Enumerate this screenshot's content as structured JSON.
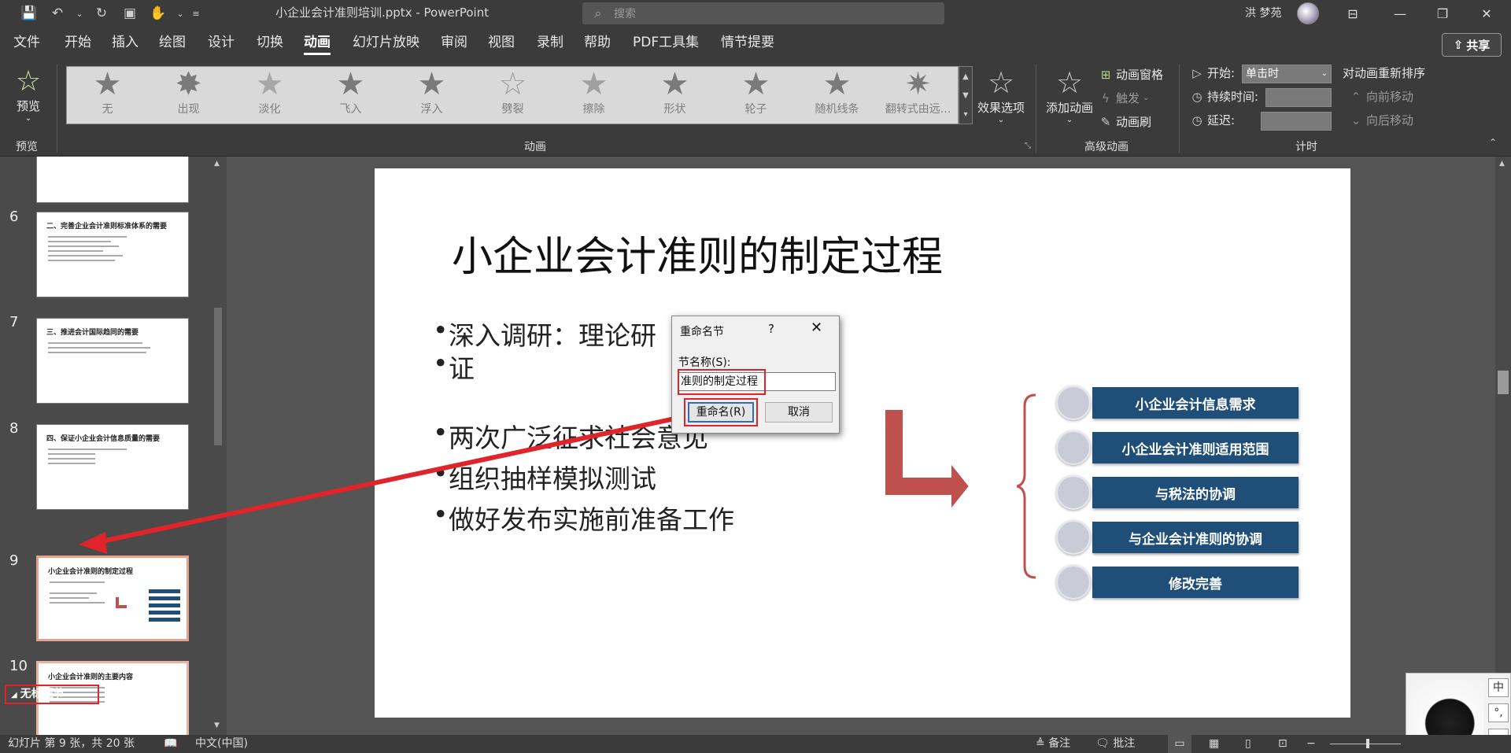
{
  "titlebar": {
    "doc_title": "小企业会计准则培训.pptx  -  PowerPoint",
    "search_placeholder": "搜索",
    "user_name": "洪 梦苑"
  },
  "tabs": [
    "文件",
    "开始",
    "插入",
    "绘图",
    "设计",
    "切换",
    "动画",
    "幻灯片放映",
    "审阅",
    "视图",
    "录制",
    "帮助",
    "PDF工具集",
    "情节提要"
  ],
  "active_tab": "动画",
  "share_label": "共享",
  "ribbon": {
    "preview_label": "预览",
    "preview_group": "预览",
    "animation_group": "动画",
    "animations": [
      "无",
      "出现",
      "淡化",
      "飞入",
      "浮入",
      "劈裂",
      "擦除",
      "形状",
      "轮子",
      "随机线条",
      "翻转式由远..."
    ],
    "effect_options": "效果选项",
    "add_animation": "添加动画",
    "animation_pane": "动画窗格",
    "trigger": "触发",
    "animation_painter": "动画刷",
    "advanced_group": "高级动画",
    "start_label": "开始:",
    "start_value": "单击时",
    "duration_label": "持续时间:",
    "delay_label": "延迟:",
    "reorder_label": "对动画重新排序",
    "move_earlier": "向前移动",
    "move_later": "向后移动",
    "timing_group": "计时"
  },
  "thumbnails": [
    {
      "num": "6",
      "title": "二、完善企业会计准则标准体系的需要"
    },
    {
      "num": "7",
      "title": "三、推进会计国际趋同的需要"
    },
    {
      "num": "8",
      "title": "四、保证小企业会计信息质量的需要"
    },
    {
      "num": "9",
      "title": "小企业会计准则的制定过程"
    },
    {
      "num": "10",
      "title": "小企业会计准则的主要内容"
    }
  ],
  "section_header": "无标题节",
  "slide": {
    "title": "小企业会计准则的制定过程",
    "bullets": [
      "深入调研：理论研",
      "证",
      "两次广泛征求社会意见",
      "组织抽样模拟测试",
      "做好发布实施前准备工作"
    ],
    "items": [
      "小企业会计信息需求",
      "小企业会计准则适用范围",
      "与税法的协调",
      "与企业会计准则的协调",
      "修改完善"
    ],
    "accent": "#1f4e79",
    "arrow_color": "#c0504d"
  },
  "dialog": {
    "title": "重命名节",
    "help": "?",
    "close": "✕",
    "field_label": "节名称(S):",
    "field_value": "准则的制定过程",
    "ok_label": "重命名(R)",
    "cancel_label": "取消"
  },
  "ime": {
    "keys": [
      "中",
      "°,",
      "⌂"
    ]
  },
  "statusbar": {
    "slide_info": "幻灯片 第 9 张，共 20 张",
    "language": "中文(中国)",
    "notes": "备注",
    "comments": "批注"
  }
}
